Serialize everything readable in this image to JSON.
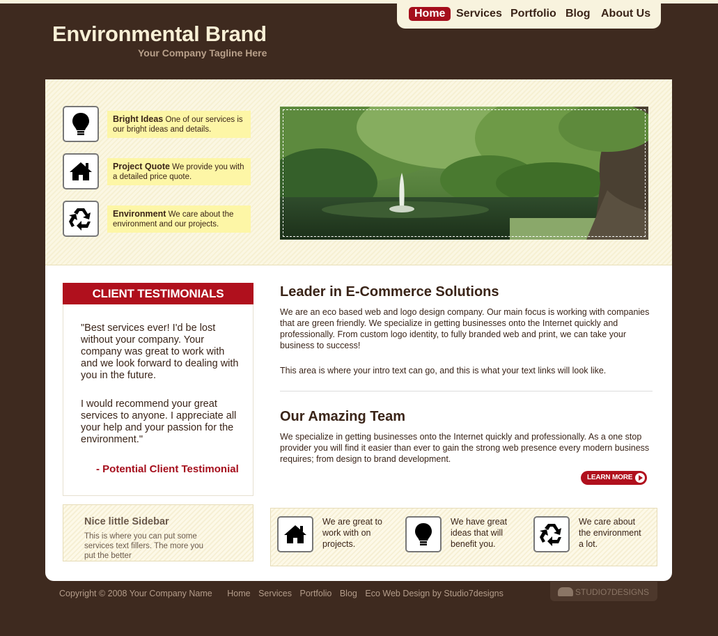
{
  "brand": {
    "name": "Environmental Brand",
    "tagline": "Your Company Tagline Here"
  },
  "nav": {
    "items": [
      "Home",
      "Services",
      "Portfolio",
      "Blog",
      "About Us"
    ],
    "active": "Home"
  },
  "hero": {
    "features": [
      {
        "title": "Bright Ideas",
        "text": "One of our services is our bright ideas and details.",
        "icon": "lightbulb-icon"
      },
      {
        "title": "Project Quote",
        "text": "We provide you with a detailed price quote.",
        "icon": "house-icon"
      },
      {
        "title": "Environment",
        "text": "We care about the environment and our projects.",
        "icon": "recycle-icon"
      }
    ]
  },
  "testimonials": {
    "heading": "CLIENT TESTIMONIALS",
    "paragraph1": "\"Best services ever! I'd be lost without your company. Your company was great to work with and we look forward to dealing with you in the future.",
    "paragraph2": "I would recommend your great services to anyone. I appreciate all your help and your passion for the environment.\"",
    "signature": "- Potential Client Testimonial"
  },
  "sidebar": {
    "title": "Nice little Sidebar",
    "text": "This is where you can put some services text fillers. The more you put the better"
  },
  "main": {
    "heading1": "Leader in E-Commerce Solutions",
    "para1": "We are an eco based web and logo design company. Our main focus is working with companies that are green friendly. We specialize in getting businesses onto the Internet quickly and professionally. From custom logo identity, to fully branded web and print, we can take your business to success!",
    "para2": "This area is where your intro text can go, and this is what your text links will look like.",
    "heading2": "Our Amazing Team",
    "para3": "We specialize in getting businesses onto the Internet quickly and professionally. As a one stop provider you will find it easier than ever to gain the strong web presence every modern business requires; from design to brand development.",
    "read_more": "LEARN MORE"
  },
  "services": [
    {
      "text": "We are great to work with on projects.",
      "icon": "house-icon"
    },
    {
      "text": "We have great ideas that will benefit you.",
      "icon": "lightbulb-icon"
    },
    {
      "text": "We care about the environment a lot.",
      "icon": "recycle-icon"
    }
  ],
  "footer": {
    "copyright": "Copyright © 2008 Your Company Name",
    "links": [
      "Home",
      "Services",
      "Portfolio",
      "Blog",
      "Eco Web Design by Studio7designs"
    ],
    "badge": "STUDIO7DESIGNS"
  },
  "colors": {
    "background": "#3e2a1f",
    "cream": "#f8f3de",
    "accent": "#a50e1c",
    "note": "#fdf6a6"
  }
}
